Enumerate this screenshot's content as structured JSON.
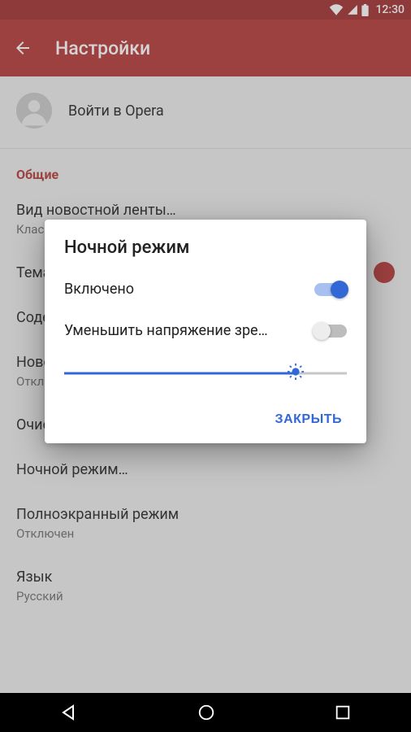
{
  "status_bar": {
    "clock": "12:30"
  },
  "app_bar": {
    "title": "Настройки"
  },
  "sign_in": {
    "text": "Войти в Opera"
  },
  "sections": {
    "general_header": "Общие"
  },
  "items": {
    "view": {
      "primary": "Вид новостной ленты…",
      "secondary": "Классический"
    },
    "theme": {
      "primary": "Тема"
    },
    "content": {
      "primary": "Содержимое…"
    },
    "news": {
      "primary": "Новости",
      "secondary": "Отключены"
    },
    "clear": {
      "primary": "Очистить…"
    },
    "night": {
      "primary": "Ночной режим…"
    },
    "fullscreen": {
      "primary": "Полноэкранный режим",
      "secondary": "Отключен"
    },
    "language": {
      "primary": "Язык",
      "secondary": "Русский"
    }
  },
  "dialog": {
    "title": "Ночной режим",
    "row1": "Включено",
    "row1_on": true,
    "row2": "Уменьшить напряжение зрен…",
    "row2_on": false,
    "slider_percent": 82,
    "close": "ЗАКРЫТЬ"
  },
  "colors": {
    "accent": "#b33232",
    "blue": "#3268d6"
  }
}
